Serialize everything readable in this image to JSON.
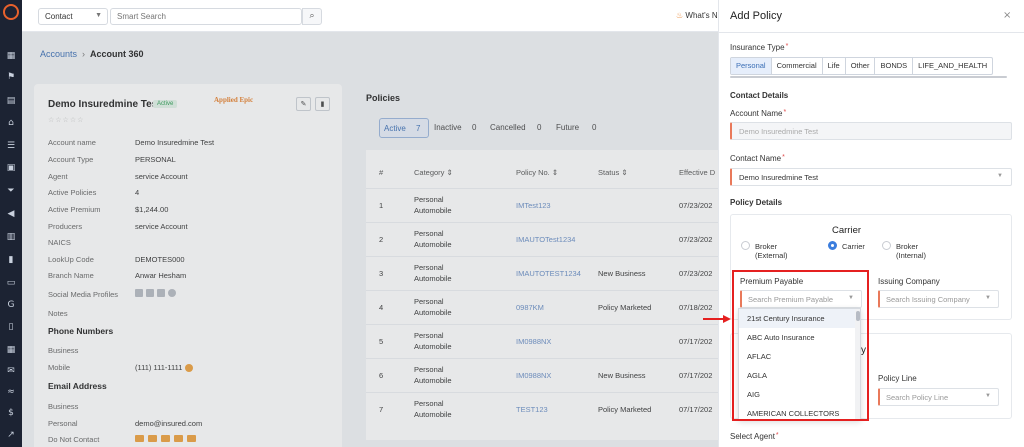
{
  "topbar": {
    "contact_select": "Contact",
    "search_placeholder": "Smart Search",
    "whats_new": "What's N"
  },
  "breadcrumb": {
    "parent": "Accounts",
    "current": "Account 360"
  },
  "account": {
    "name": "Demo Insuredmine Test",
    "status": "Active",
    "brand": "Applied Epic",
    "stars": "☆☆☆☆☆",
    "fields": [
      {
        "label": "Account name",
        "value": "Demo Insuredmine Test"
      },
      {
        "label": "Account Type",
        "value": "PERSONAL"
      },
      {
        "label": "Agent",
        "value": "service Account"
      },
      {
        "label": "Active Policies",
        "value": "4"
      },
      {
        "label": "Active Premium",
        "value": "$1,244.00"
      },
      {
        "label": "Producers",
        "value": "service Account"
      },
      {
        "label": "NAICS",
        "value": ""
      },
      {
        "label": "LookUp Code",
        "value": "DEMOTES000"
      },
      {
        "label": "Branch Name",
        "value": "Anwar Hesham"
      },
      {
        "label": "Social Media Profiles",
        "value": ""
      },
      {
        "label": "Notes",
        "value": ""
      }
    ],
    "phone_heading": "Phone Numbers",
    "phone_fields": [
      {
        "label": "Business",
        "value": ""
      },
      {
        "label": "Mobile",
        "value": "(111) 111-1111"
      }
    ],
    "email_heading": "Email Address",
    "email_fields": [
      {
        "label": "Business",
        "value": ""
      },
      {
        "label": "Personal",
        "value": "demo@insured.com"
      },
      {
        "label": "Do Not Contact",
        "value": ""
      }
    ]
  },
  "policies": {
    "title": "Policies",
    "filters": [
      {
        "label": "Active",
        "count": "7"
      },
      {
        "label": "Inactive",
        "count": "0"
      },
      {
        "label": "Cancelled",
        "count": "0"
      },
      {
        "label": "Future",
        "count": "0"
      }
    ],
    "headers": [
      "#",
      "Category ⇕",
      "Policy No. ⇕",
      "Status ⇕",
      "Effective D"
    ],
    "rows": [
      {
        "num": "1",
        "cat1": "Personal",
        "cat2": "Automobile",
        "policy": "IMTest123",
        "status": "",
        "eff": "07/23/202"
      },
      {
        "num": "2",
        "cat1": "Personal",
        "cat2": "Automobile",
        "policy": "IMAUTOTest1234",
        "status": "",
        "eff": "07/23/202"
      },
      {
        "num": "3",
        "cat1": "Personal",
        "cat2": "Automobile",
        "policy": "IMAUTOTEST1234",
        "status": "New Business",
        "eff": "07/23/202"
      },
      {
        "num": "4",
        "cat1": "Personal",
        "cat2": "Automobile",
        "policy": "0987KM",
        "status": "Policy Marketed",
        "eff": "07/18/202"
      },
      {
        "num": "5",
        "cat1": "Personal",
        "cat2": "Automobile",
        "policy": "IM0988NX",
        "status": "",
        "eff": "07/17/202"
      },
      {
        "num": "6",
        "cat1": "Personal",
        "cat2": "Automobile",
        "policy": "IM0988NX",
        "status": "New Business",
        "eff": "07/17/202"
      },
      {
        "num": "7",
        "cat1": "Personal",
        "cat2": "Automobile",
        "policy": "TEST123",
        "status": "Policy Marketed",
        "eff": "07/17/202"
      }
    ]
  },
  "drawer": {
    "title": "Add Policy",
    "close": "×",
    "insurance_type_label": "Insurance Type",
    "insurance_types": [
      "Personal",
      "Commercial",
      "Life",
      "Other",
      "BONDS",
      "LIFE_AND_HEALTH"
    ],
    "contact_details_heading": "Contact Details",
    "account_name_label": "Account Name",
    "account_name_value": "Demo Insuredmine Test",
    "contact_name_label": "Contact Name",
    "contact_name_value": "Demo Insuredmine Test",
    "policy_details_heading": "Policy Details",
    "carrier_title": "Carrier",
    "radios": [
      {
        "l1": "Broker",
        "l2": "(External)"
      },
      {
        "l1": "Carrier",
        "l2": ""
      },
      {
        "l1": "Broker",
        "l2": "(Internal)"
      }
    ],
    "premium_payable_label": "Premium Payable",
    "premium_payable_placeholder": "Search Premium Payable",
    "issuing_company_label": "Issuing Company",
    "issuing_company_placeholder": "Search Issuing Company",
    "policy_line_label": "Policy Line",
    "policy_line_placeholder": "Search Policy Line",
    "partial_heading_char": "y",
    "select_agent_label": "Select Agent",
    "dropdown_options": [
      "21st Century Insurance",
      "ABC Auto Insurance",
      "AFLAC",
      "AGLA",
      "AIG",
      "AMERICAN COLLECTORS"
    ]
  },
  "colors": {
    "accent": "#3b6fb6",
    "required_marker": "#e9795a",
    "highlight_box": "#e52020",
    "rail": "#1c2333"
  }
}
